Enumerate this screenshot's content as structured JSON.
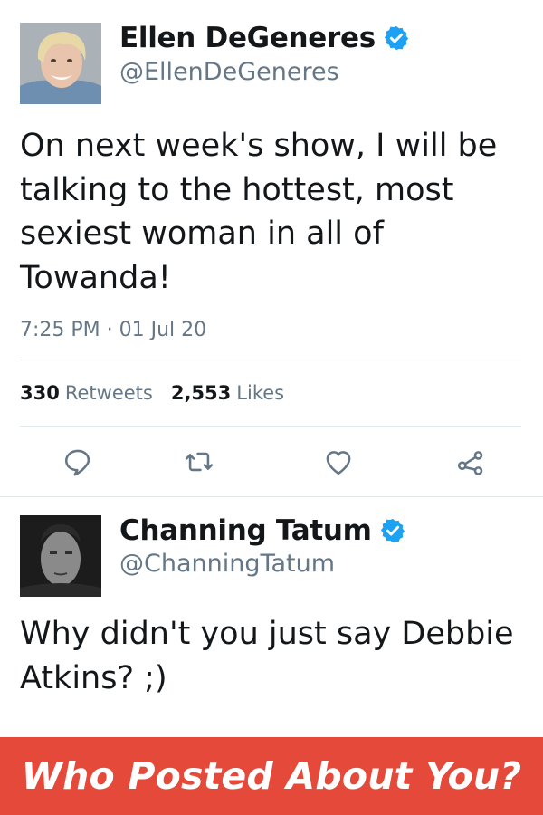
{
  "tweets": [
    {
      "display_name": "Ellen DeGeneres",
      "handle": "@EllenDeGeneres",
      "verified": true,
      "text": "On next week's show, I will be talking to the hottest, most sexiest woman in all of Towanda!",
      "timestamp": "7:25 PM · 01 Jul 20",
      "retweets": {
        "count": "330",
        "label": "Retweets"
      },
      "likes": {
        "count": "2,553",
        "label": "Likes"
      },
      "actions": [
        "reply-icon",
        "retweet-icon",
        "like-icon",
        "share-icon"
      ]
    },
    {
      "display_name": "Channing Tatum",
      "handle": "@ChanningTatum",
      "verified": true,
      "text": "Why didn't you just say Debbie Atkins? ;)"
    }
  ],
  "banner": {
    "text": "Who Posted About You?"
  },
  "colors": {
    "verified_blue": "#1da1f2",
    "secondary_text": "#657786",
    "banner_red": "#e5493a",
    "divider": "#e1e8ed"
  }
}
